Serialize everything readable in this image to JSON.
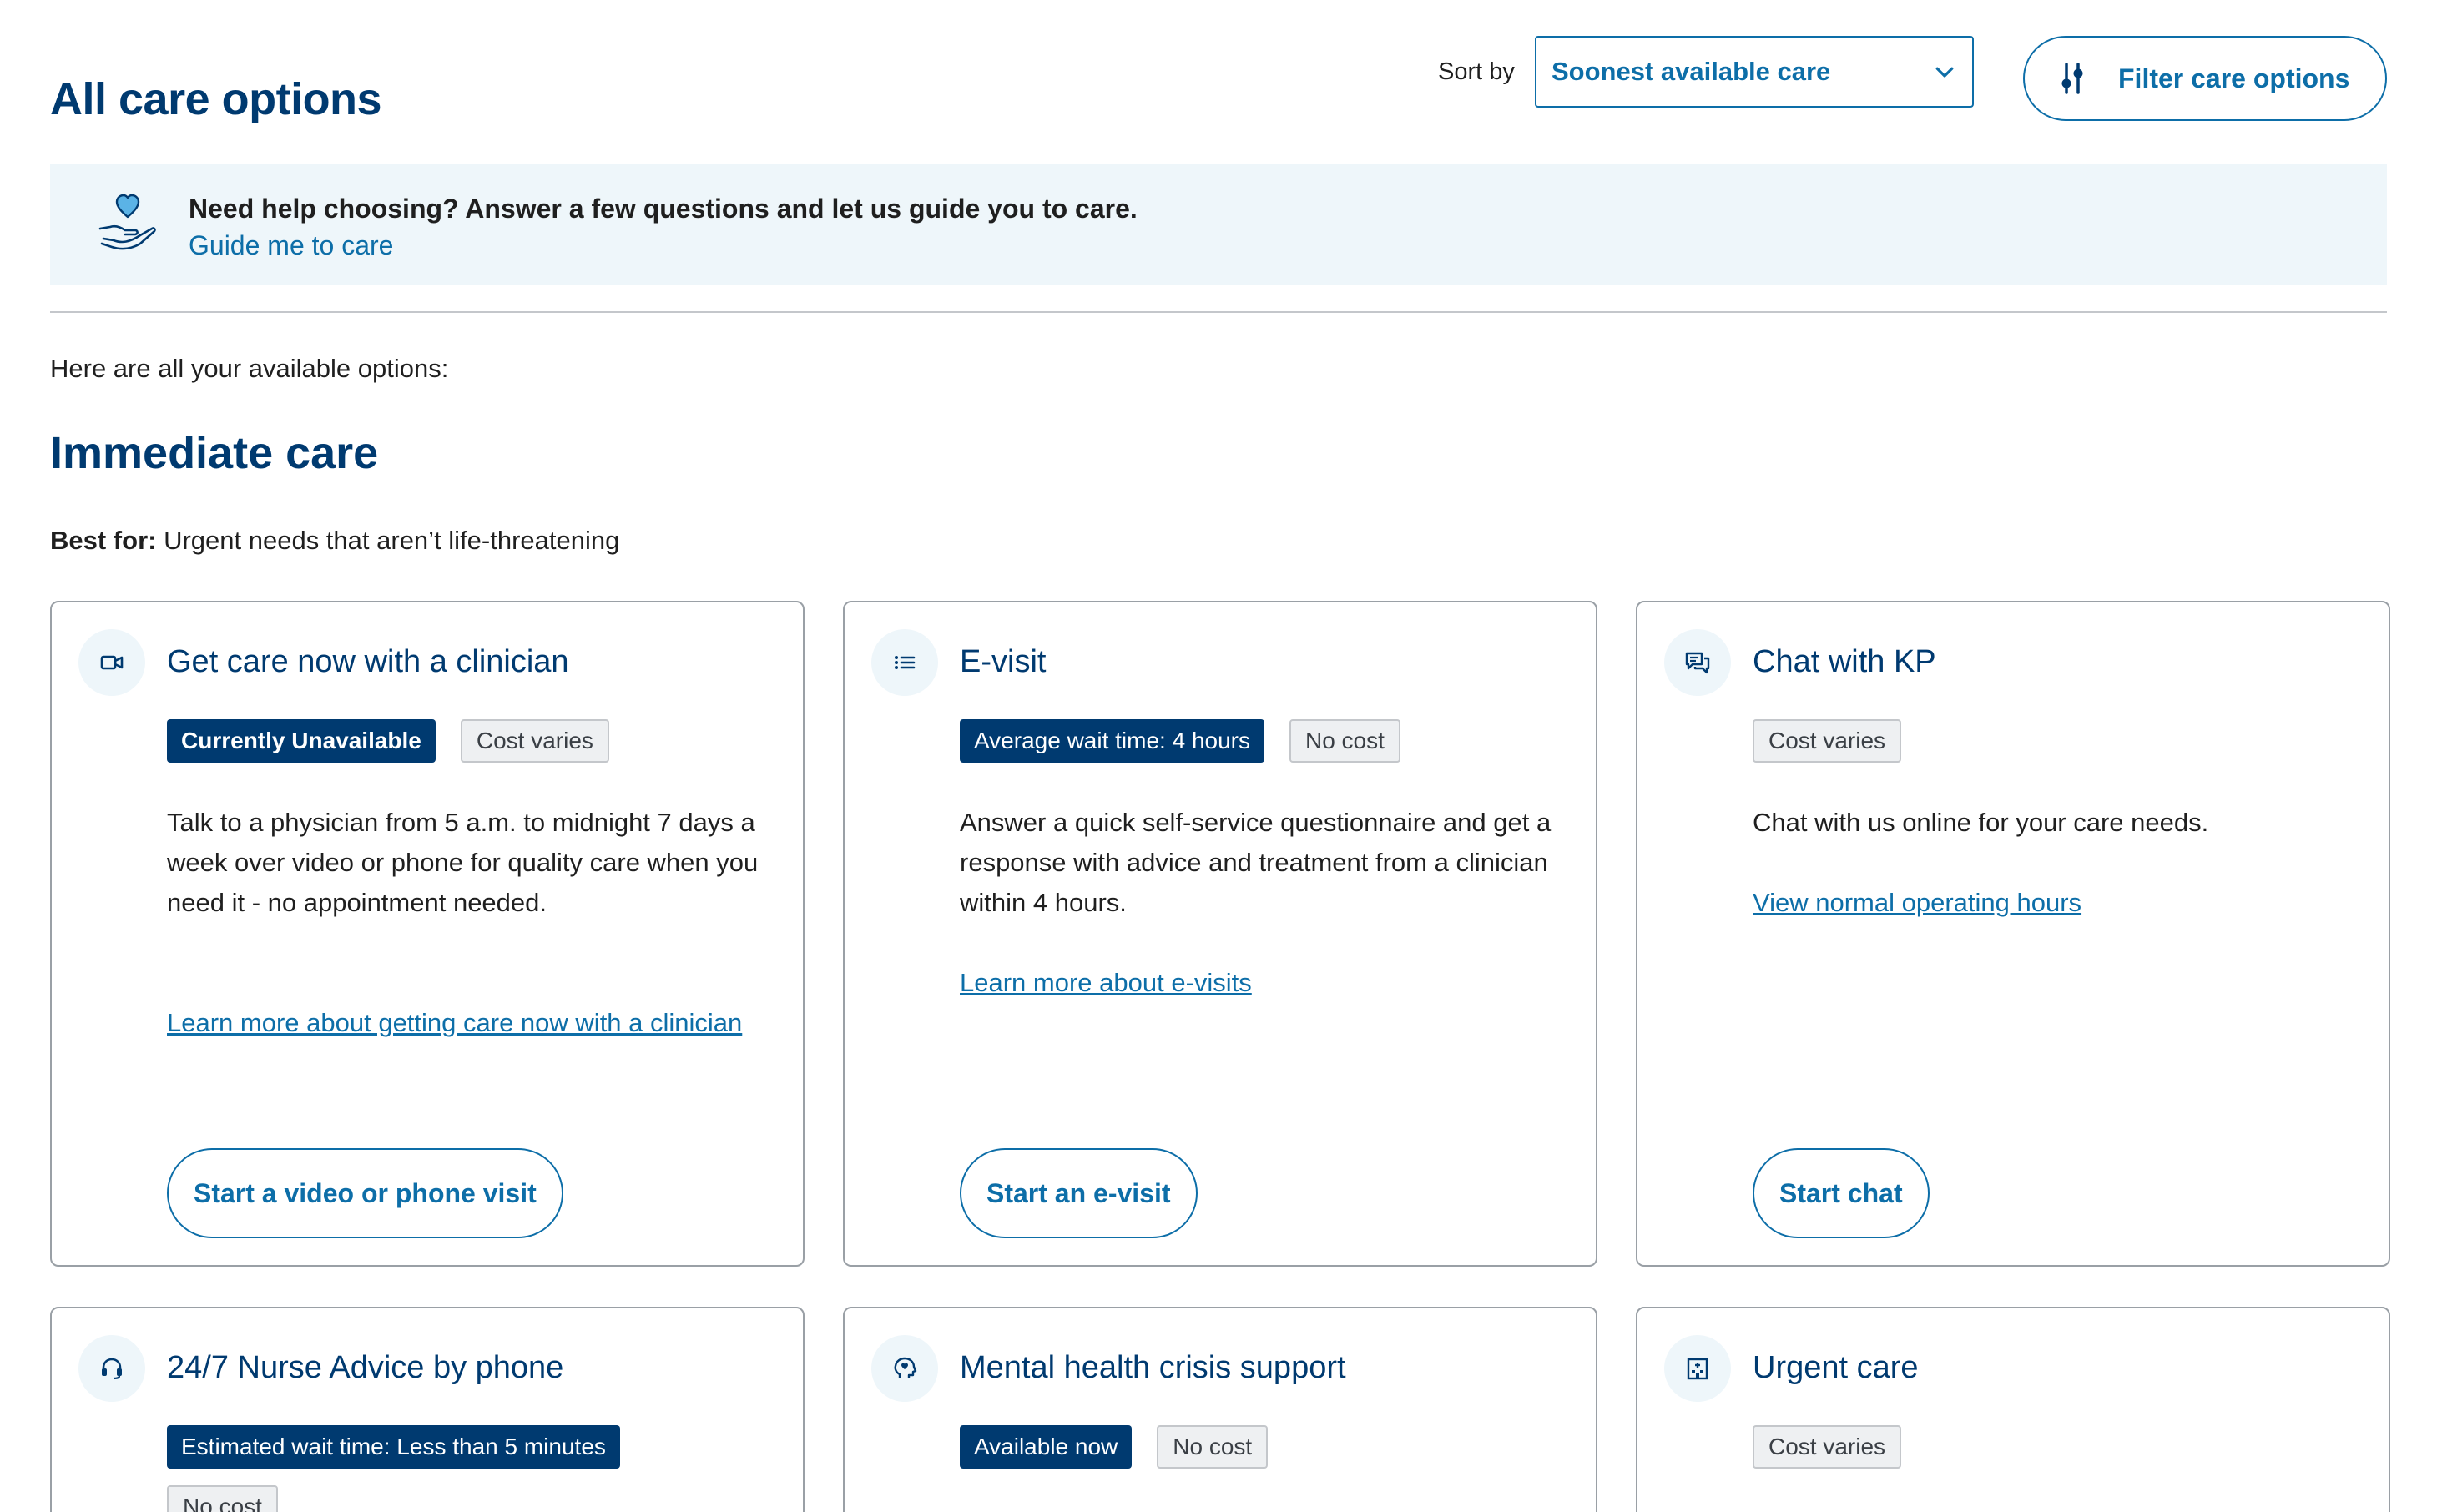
{
  "header": {
    "title": "All care options",
    "sort_label": "Sort by",
    "sort_value": "Soonest available care",
    "filter_label": "Filter care options"
  },
  "help": {
    "question": "Need help choosing? Answer a few questions and let us guide you to care.",
    "link": "Guide me to care"
  },
  "intro": "Here are all your available options:",
  "section": {
    "title": "Immediate care",
    "best_for_label": "Best for:",
    "best_for_text": "Urgent needs that aren’t life-threatening"
  },
  "cards": [
    {
      "icon": "video-camera-icon",
      "title": "Get care now with a clinician",
      "badges": [
        "Currently Unavailable",
        "Cost varies"
      ],
      "description": "Talk to a physician from 5 a.m. to midnight 7 days a week over video or phone for quality care when you need it - no appointment needed.",
      "link": "Learn more about getting care now with a clinician",
      "button": "Start a video or phone visit"
    },
    {
      "icon": "list-icon",
      "title": "E-visit",
      "badges": [
        "Average wait time: 4 hours",
        "No cost"
      ],
      "description": "Answer a quick self-service questionnaire and get a response with advice and treatment from a clinician within 4 hours.",
      "link": "Learn more about e-visits",
      "button": "Start an e-visit"
    },
    {
      "icon": "chat-bubbles-icon",
      "title": "Chat with KP",
      "badges": [
        "Cost varies"
      ],
      "description": "Chat with us online for your care needs.",
      "link": "View normal operating hours",
      "button": "Start chat"
    },
    {
      "icon": "headset-icon",
      "title": "24/7 Nurse Advice by phone",
      "badges": [
        "Estimated wait time: Less than 5 minutes",
        "No cost"
      ]
    },
    {
      "icon": "head-heart-icon",
      "title": "Mental health crisis support",
      "badges": [
        "Available now",
        "No cost"
      ]
    },
    {
      "icon": "building-icon",
      "title": "Urgent care",
      "badges": [
        "Cost varies"
      ]
    }
  ],
  "colors": {
    "navy": "#003a70",
    "link_blue": "#0d6ea8",
    "banner_bg": "#eef6fa"
  }
}
